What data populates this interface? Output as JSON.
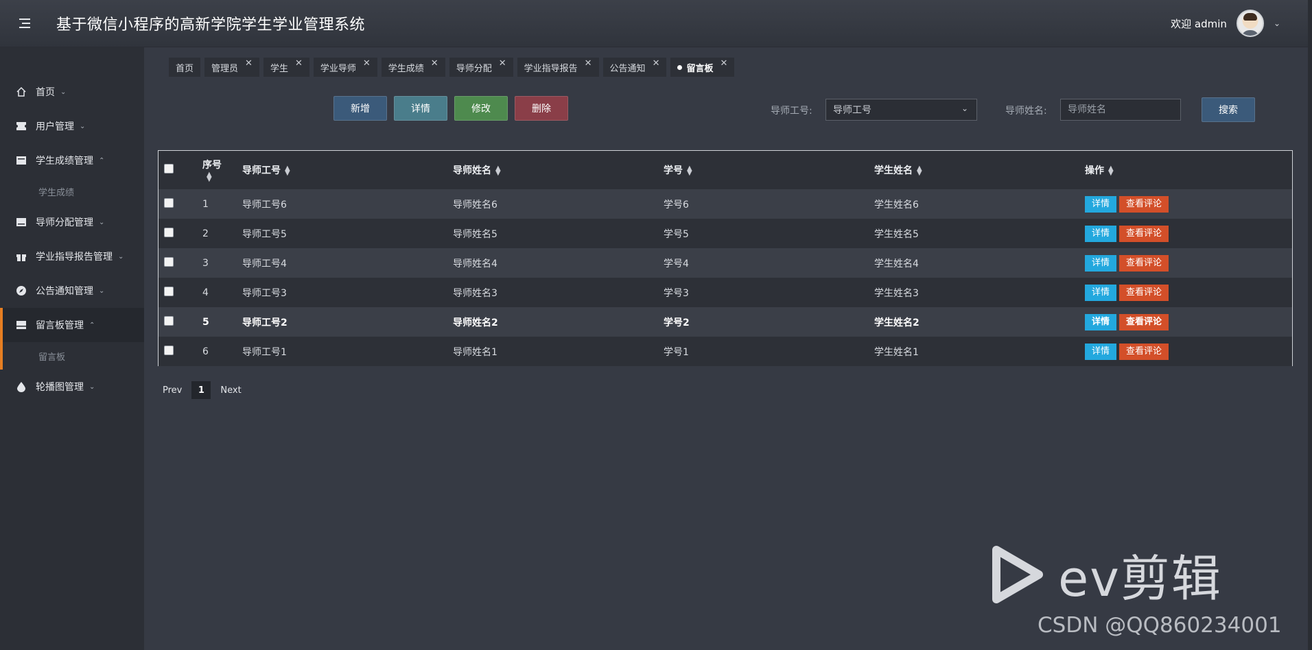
{
  "header": {
    "title": "基于微信小程序的高新学院学生学业管理系统",
    "welcome": "欢迎 admin"
  },
  "sidebar": {
    "items": [
      {
        "label": "首页",
        "icon": "home-icon",
        "expanded": false
      },
      {
        "label": "用户管理",
        "icon": "ticket-icon",
        "expanded": false
      },
      {
        "label": "学生成绩管理",
        "icon": "doc-icon",
        "expanded": true,
        "sub": [
          "学生成绩"
        ]
      },
      {
        "label": "导师分配管理",
        "icon": "inbox-icon",
        "expanded": false
      },
      {
        "label": "学业指导报告管理",
        "icon": "gift-icon",
        "expanded": false
      },
      {
        "label": "公告通知管理",
        "icon": "compass-icon",
        "expanded": false
      },
      {
        "label": "留言板管理",
        "icon": "card-icon",
        "expanded": true,
        "active": true,
        "sub": [
          "留言板"
        ]
      },
      {
        "label": "轮播图管理",
        "icon": "drop-icon",
        "expanded": false
      }
    ]
  },
  "tabs": [
    "首页",
    "管理员",
    "学生",
    "学业导师",
    "学生成绩",
    "导师分配",
    "学业指导报告",
    "公告通知",
    "留言板"
  ],
  "toolbar": {
    "add": "新增",
    "detail": "详情",
    "edit": "修改",
    "delete": "删除",
    "search": "搜索"
  },
  "search": {
    "label1": "导师工号:",
    "select_value": "导师工号",
    "label2": "导师姓名:",
    "input_placeholder": "导师姓名"
  },
  "table": {
    "headers": [
      "序号",
      "导师工号",
      "导师姓名",
      "学号",
      "学生姓名",
      "操作"
    ],
    "rows": [
      {
        "idx": "1",
        "tid": "导师工号6",
        "tname": "导师姓名6",
        "sid": "学号6",
        "sname": "学生姓名6"
      },
      {
        "idx": "2",
        "tid": "导师工号5",
        "tname": "导师姓名5",
        "sid": "学号5",
        "sname": "学生姓名5"
      },
      {
        "idx": "3",
        "tid": "导师工号4",
        "tname": "导师姓名4",
        "sid": "学号4",
        "sname": "学生姓名4"
      },
      {
        "idx": "4",
        "tid": "导师工号3",
        "tname": "导师姓名3",
        "sid": "学号3",
        "sname": "学生姓名3"
      },
      {
        "idx": "5",
        "tid": "导师工号2",
        "tname": "导师姓名2",
        "sid": "学号2",
        "sname": "学生姓名2"
      },
      {
        "idx": "6",
        "tid": "导师工号1",
        "tname": "导师姓名1",
        "sid": "学号1",
        "sname": "学生姓名1"
      }
    ],
    "row_detail_label": "详情",
    "row_comment_label": "查看评论"
  },
  "pager": {
    "prev": "Prev",
    "current": "1",
    "next": "Next"
  },
  "watermark": {
    "brand": "ev剪辑",
    "credit": "CSDN @QQ860234001"
  }
}
